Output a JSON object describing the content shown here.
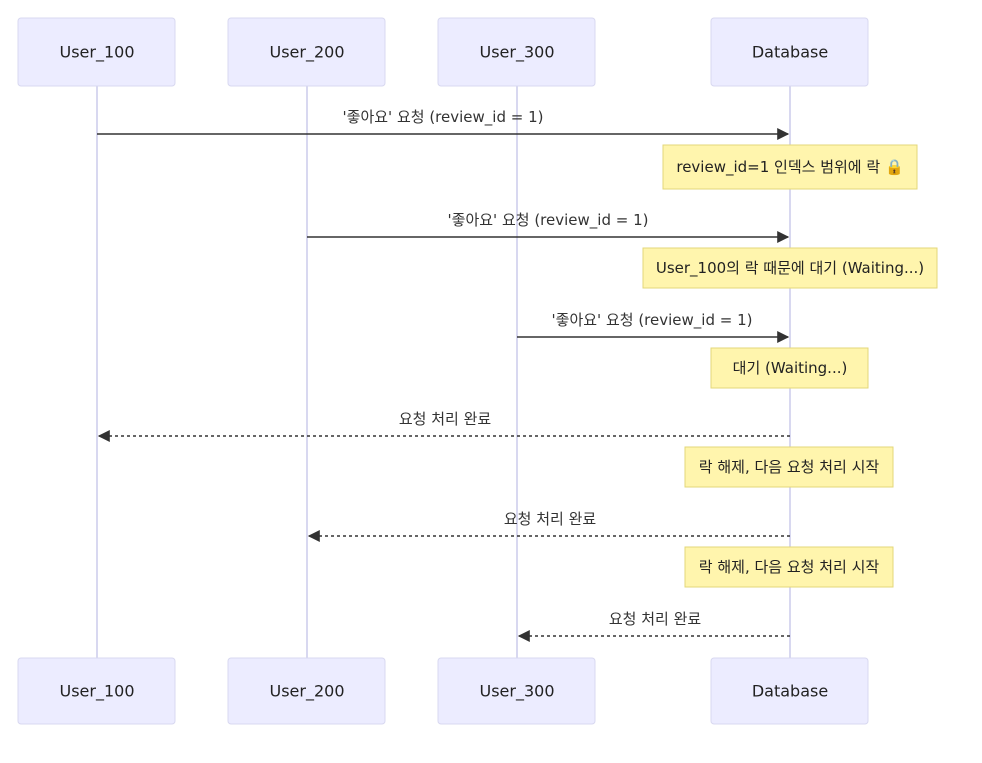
{
  "participants": [
    {
      "id": "u100",
      "label": "User_100"
    },
    {
      "id": "u200",
      "label": "User_200"
    },
    {
      "id": "u300",
      "label": "User_300"
    },
    {
      "id": "db",
      "label": "Database"
    }
  ],
  "messages": [
    {
      "from": "u100",
      "to": "db",
      "label": "'좋아요' 요청 (review_id = 1)",
      "style": "solid"
    },
    {
      "from": "u200",
      "to": "db",
      "label": "'좋아요' 요청 (review_id = 1)",
      "style": "solid"
    },
    {
      "from": "u300",
      "to": "db",
      "label": "'좋아요' 요청 (review_id = 1)",
      "style": "solid"
    },
    {
      "from": "db",
      "to": "u100",
      "label": "요청 처리 완료",
      "style": "dashed"
    },
    {
      "from": "db",
      "to": "u200",
      "label": "요청 처리 완료",
      "style": "dashed"
    },
    {
      "from": "db",
      "to": "u300",
      "label": "요청 처리 완료",
      "style": "dashed"
    }
  ],
  "notes": [
    {
      "over": "db",
      "label": "review_id=1 인덱스 범위에 락 🔒"
    },
    {
      "over": "db",
      "label": "User_100의 락 때문에 대기 (Waiting...)"
    },
    {
      "over": "db",
      "label": "대기 (Waiting...)"
    },
    {
      "over": "db",
      "label": "락 해제, 다음 요청 처리 시작"
    },
    {
      "over": "db",
      "label": "락 해제, 다음 요청 처리 시작"
    }
  ]
}
